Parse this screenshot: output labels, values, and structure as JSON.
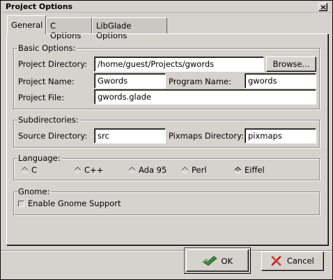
{
  "window": {
    "title": "Project Options"
  },
  "tabs": [
    {
      "label": "General",
      "active": true
    },
    {
      "label": "C Options",
      "active": false
    },
    {
      "label": "LibGlade Options",
      "active": false
    }
  ],
  "basic": {
    "legend": "Basic Options:",
    "project_directory": {
      "label": "Project Directory:",
      "value": "/home/guest/Projects/gwords"
    },
    "browse_label": "Browse...",
    "project_name": {
      "label": "Project Name:",
      "value": "Gwords"
    },
    "program_name": {
      "label": "Program Name:",
      "value": "gwords"
    },
    "project_file": {
      "label": "Project File:",
      "value": "gwords.glade"
    }
  },
  "subdirs": {
    "legend": "Subdirectories:",
    "source": {
      "label": "Source Directory:",
      "value": "src"
    },
    "pixmaps": {
      "label": "Pixmaps Directory:",
      "value": "pixmaps"
    }
  },
  "language": {
    "legend": "Language:",
    "options": [
      {
        "label": "C",
        "selected": false
      },
      {
        "label": "C++",
        "selected": false
      },
      {
        "label": "Ada 95",
        "selected": false
      },
      {
        "label": "Perl",
        "selected": false
      },
      {
        "label": "Eiffel",
        "selected": true
      }
    ]
  },
  "gnome": {
    "legend": "Gnome:",
    "enable_label": "Enable Gnome Support",
    "enabled": false
  },
  "buttons": {
    "ok_label": "OK",
    "cancel_label": "Cancel"
  },
  "colors": {
    "background": "#d6d3ce",
    "ok_icon": "#3a8a3a",
    "cancel_icon": "#c01818"
  }
}
